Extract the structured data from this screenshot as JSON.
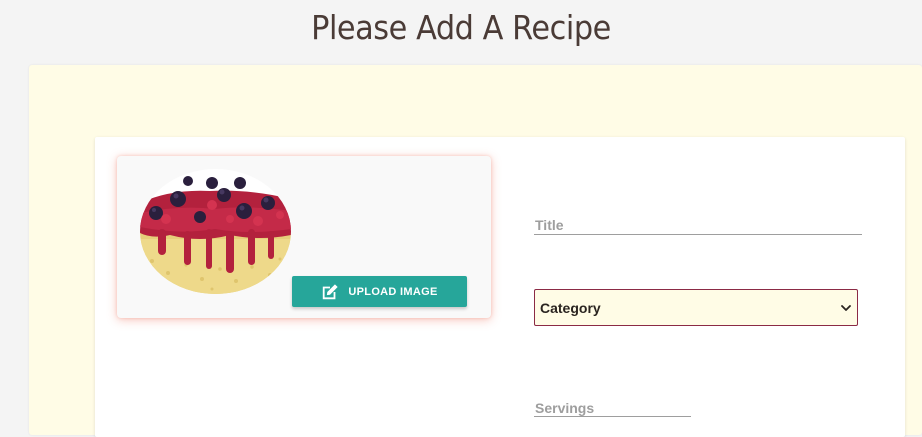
{
  "page": {
    "title": "Please Add A Recipe"
  },
  "image_card": {
    "image_alt": "berry cake slice",
    "upload_button_label": "UPLOAD IMAGE",
    "upload_icon": "edit-icon"
  },
  "form": {
    "title_label": "Title",
    "category": {
      "selected": "Category",
      "icon": "chevron-down-icon"
    },
    "servings_label": "Servings"
  },
  "colors": {
    "accent": "#26a69a",
    "panel_background": "#fffce6",
    "select_border": "#8b2a45",
    "title_text": "#4a3b36",
    "label_text": "#9e9e9e"
  }
}
